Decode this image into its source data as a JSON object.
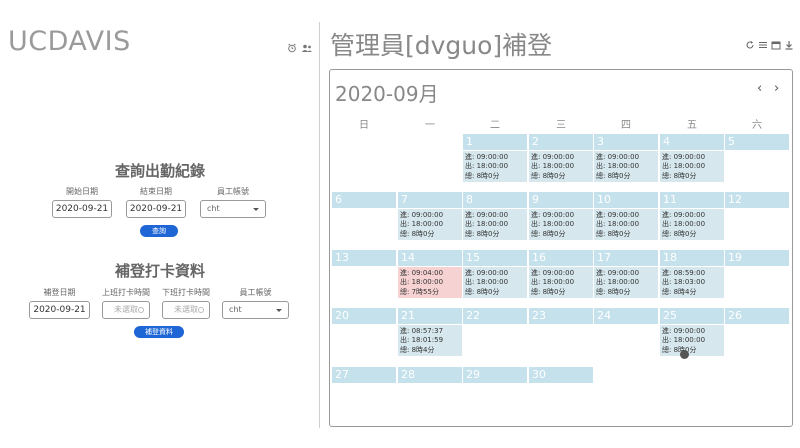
{
  "left": {
    "brand": "UCDAVIS",
    "query": {
      "title": "查詢出勤紀錄",
      "start_label": "開始日期",
      "end_label": "結束日期",
      "account_label": "員工帳號",
      "start_value": "2020-09-21",
      "end_value": "2020-09-21",
      "account_value": "cht",
      "submit": "查詢"
    },
    "punch": {
      "title": "補登打卡資料",
      "date_label": "補登日期",
      "in_label": "上班打卡時間",
      "out_label": "下班打卡時間",
      "account_label": "員工帳號",
      "date_value": "2020-09-21",
      "in_placeholder": "未選取",
      "out_placeholder": "未選取",
      "account_value": "cht",
      "submit": "補登資料"
    }
  },
  "right": {
    "title": "管理員[dvguo]補登",
    "calendar": {
      "month": "2020-09月",
      "weekdays": [
        "日",
        "一",
        "二",
        "三",
        "四",
        "五",
        "六"
      ],
      "days": [
        "1",
        "2",
        "3",
        "4",
        "5",
        "6",
        "7",
        "8",
        "9",
        "10",
        "11",
        "12",
        "13",
        "14",
        "15",
        "16",
        "17",
        "18",
        "19",
        "20",
        "21",
        "22",
        "23",
        "24",
        "25",
        "26",
        "27",
        "28",
        "29",
        "30"
      ],
      "records": [
        {
          "day": "1",
          "in": "進: 09:00:00",
          "out": "出: 18:00:00",
          "total": "總: 8時0分"
        },
        {
          "day": "2",
          "in": "進: 09:00:00",
          "out": "出: 18:00:00",
          "total": "總: 8時0分"
        },
        {
          "day": "3",
          "in": "進: 09:00:00",
          "out": "出: 18:00:00",
          "total": "總: 8時0分"
        },
        {
          "day": "4",
          "in": "進: 09:00:00",
          "out": "出: 18:00:00",
          "total": "總: 8時0分"
        },
        {
          "day": "7",
          "in": "進: 09:00:00",
          "out": "出: 18:00:00",
          "total": "總: 8時0分"
        },
        {
          "day": "8",
          "in": "進: 09:00:00",
          "out": "出: 18:00:00",
          "total": "總: 8時0分"
        },
        {
          "day": "9",
          "in": "進: 09:00:00",
          "out": "出: 18:00:00",
          "total": "總: 8時0分"
        },
        {
          "day": "10",
          "in": "進: 09:00:00",
          "out": "出: 18:00:00",
          "total": "總: 8時0分"
        },
        {
          "day": "11",
          "in": "進: 09:00:00",
          "out": "出: 18:00:00",
          "total": "總: 8時0分"
        },
        {
          "day": "14",
          "in": "進: 09:04:00",
          "out": "出: 18:00:00",
          "total": "總: 7時55分",
          "late": true
        },
        {
          "day": "15",
          "in": "進: 09:00:00",
          "out": "出: 18:00:00",
          "total": "總: 8時0分"
        },
        {
          "day": "16",
          "in": "進: 09:00:00",
          "out": "出: 18:00:00",
          "total": "總: 8時0分"
        },
        {
          "day": "17",
          "in": "進: 09:00:00",
          "out": "出: 18:00:00",
          "total": "總: 8時0分"
        },
        {
          "day": "18",
          "in": "進: 08:59:00",
          "out": "出: 18:03:00",
          "total": "總: 8時4分"
        },
        {
          "day": "21",
          "in": "進: 08:57:37",
          "out": "出: 18:01:59",
          "total": "總: 8時4分"
        },
        {
          "day": "25",
          "in": "進: 09:00:00",
          "out": "出: 18:00:00",
          "total": "總: 8時0分"
        }
      ]
    }
  },
  "icons": {
    "alarm": "alarm-clock-icon",
    "users": "users-icon",
    "refresh": "refresh-icon",
    "list": "list-icon",
    "calendar": "calendar-icon",
    "download": "download-icon"
  },
  "colors": {
    "accent": "#1e66d6",
    "day_header": "#c5e1ec",
    "record": "#d6e8ee",
    "record_late": "#f7d2d3"
  }
}
